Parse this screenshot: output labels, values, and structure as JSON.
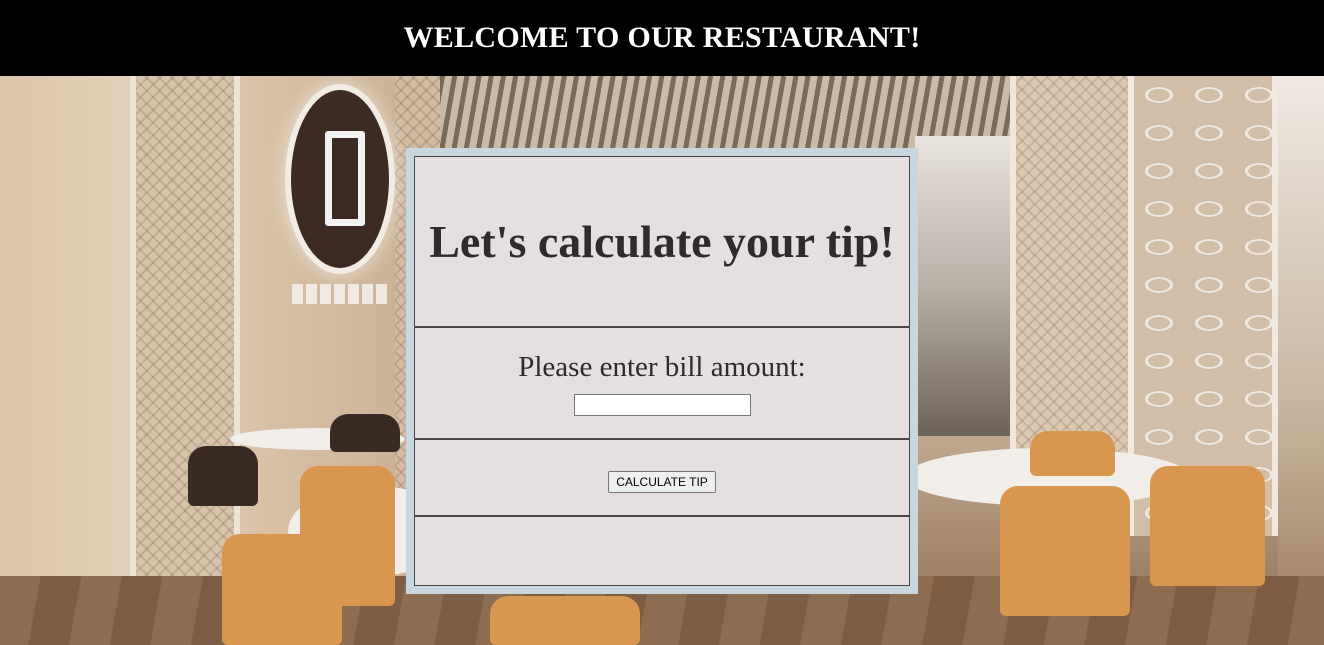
{
  "header": {
    "title": "WELCOME TO OUR RESTAURANT!"
  },
  "calculator": {
    "heading": "Let's calculate your tip!",
    "prompt": "Please enter bill amount:",
    "bill_input": {
      "value": "",
      "placeholder": ""
    },
    "button_label": "CALCULATE TIP",
    "result": ""
  },
  "colors": {
    "header_bg": "#000000",
    "header_text": "#ffffff",
    "card_frame": "#c8d6df",
    "card_bg": "#e6dfe0",
    "divider": "#4d4749"
  },
  "background": {
    "icon": "restaurant-interior-photo"
  }
}
